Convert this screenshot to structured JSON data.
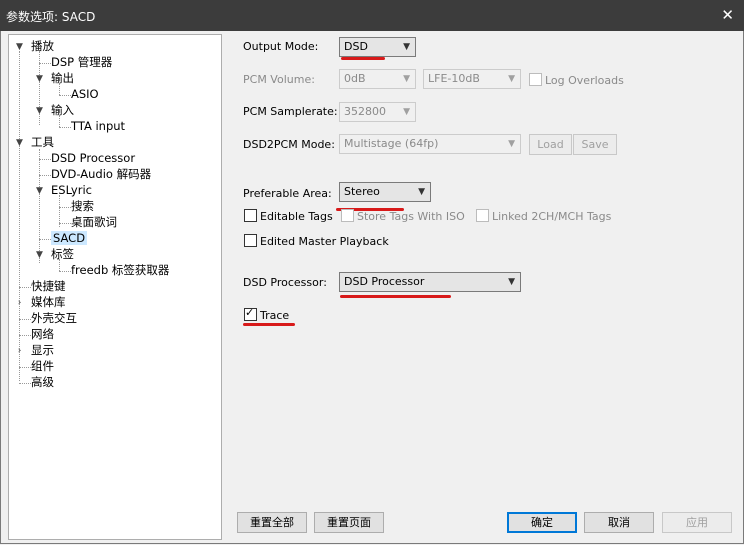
{
  "window": {
    "title": "参数选项: SACD",
    "close_glyph": "✕"
  },
  "tree": {
    "playback": "播放",
    "dsp": "DSP 管理器",
    "output": "输出",
    "asio": "ASIO",
    "input": "输入",
    "tta": "TTA input",
    "tools": "工具",
    "dsp_processor": "DSD Processor",
    "dvd_audio": "DVD-Audio 解码器",
    "eslyric": "ESLyric",
    "search": "搜索",
    "desktop_lyrics": "桌面歌词",
    "sacd": "SACD",
    "tags": "标签",
    "freedb": "freedb 标签获取器",
    "shortcuts": "快捷键",
    "media_library": "媒体库",
    "shell": "外壳交互",
    "network": "网络",
    "display": "显示",
    "components": "组件",
    "advanced": "高级"
  },
  "settings": {
    "output_mode_label": "Output Mode:",
    "output_mode_value": "DSD",
    "pcm_volume_label": "PCM Volume:",
    "pcm_volume_value": "0dB",
    "lfe_value": "LFE-10dB",
    "log_overloads": "Log Overloads",
    "pcm_samplerate_label": "PCM Samplerate:",
    "pcm_samplerate_value": "352800",
    "dsd2pcm_label": "DSD2PCM Mode:",
    "dsd2pcm_value": "Multistage (64fp)",
    "load": "Load",
    "save": "Save",
    "preferable_area_label": "Preferable Area:",
    "preferable_area_value": "Stereo",
    "editable_tags": "Editable Tags",
    "store_tags_iso": "Store Tags With ISO",
    "linked_2ch": "Linked 2CH/MCH Tags",
    "edited_master": "Edited Master Playback",
    "dsd_processor_label": "DSD Processor:",
    "dsd_processor_value": "DSD Processor",
    "trace": "Trace",
    "trace_checked": true
  },
  "footer": {
    "reset_all": "重置全部",
    "reset_page": "重置页面",
    "ok": "确定",
    "cancel": "取消",
    "apply": "应用"
  },
  "colors": {
    "annotation": "#d81a1a",
    "selection": "#cce8ff",
    "titlebar": "#3c3c3c"
  }
}
